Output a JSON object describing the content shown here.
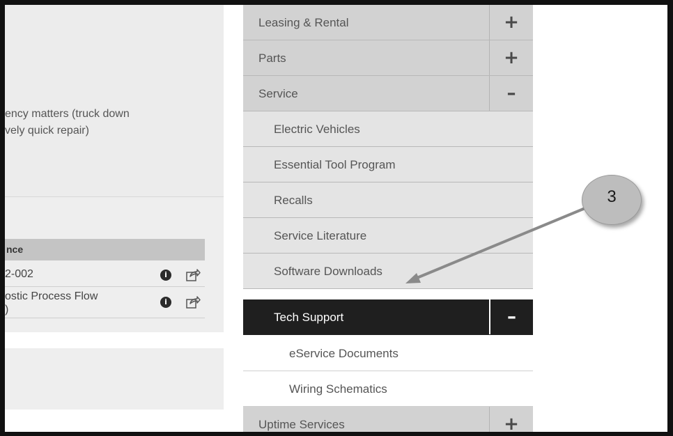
{
  "content": {
    "body_text": "ency matters (truck down\nvely quick repair)",
    "references": {
      "header": "nce",
      "rows": [
        {
          "text": "2-002",
          "info_icon": "info-icon",
          "share_icon": "share-icon"
        },
        {
          "text": "ostic Process Flow\n)",
          "info_icon": "info-icon",
          "share_icon": "share-icon"
        }
      ],
      "info_glyph": "i"
    }
  },
  "menu": {
    "items": [
      {
        "label": "Leasing & Rental",
        "toggle": "+"
      },
      {
        "label": "Parts",
        "toggle": "+"
      },
      {
        "label": "Service",
        "toggle": "–"
      },
      {
        "label": "Electric Vehicles"
      },
      {
        "label": "Essential Tool Program"
      },
      {
        "label": "Recalls"
      },
      {
        "label": "Service Literature"
      },
      {
        "label": "Software Downloads"
      },
      {
        "label": "Tech Support",
        "toggle": "–"
      },
      {
        "label": "eService Documents"
      },
      {
        "label": "Wiring Schematics"
      },
      {
        "label": "Uptime Services",
        "toggle": "+"
      }
    ]
  },
  "annotation": {
    "callout_number": "3"
  },
  "colors": {
    "active_item_bg": "#1f1f1f",
    "level1_bg": "#d2d2d2",
    "level2_bg": "#e4e4e4",
    "level3_bg": "#ffffff",
    "callout_bg": "#bdbdbd"
  }
}
